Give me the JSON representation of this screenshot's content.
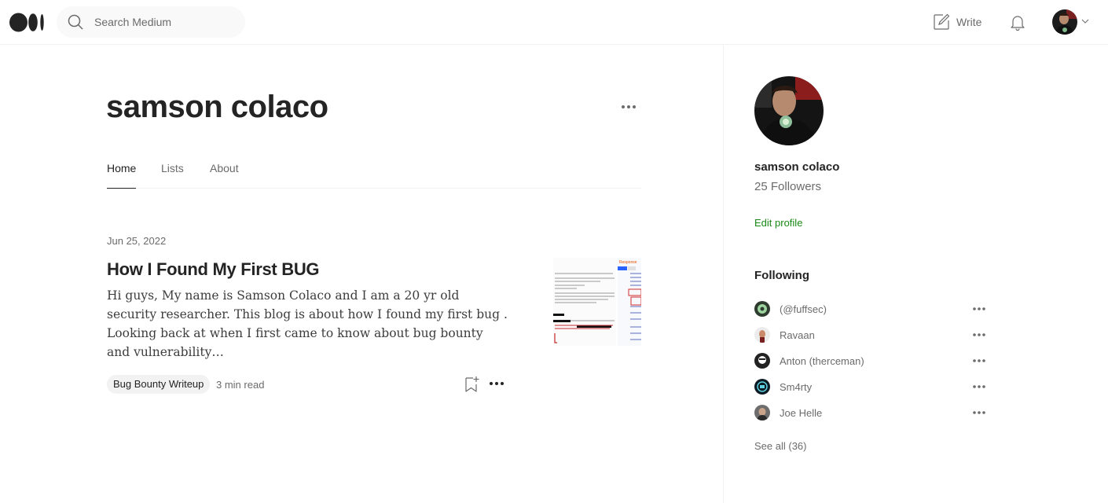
{
  "header": {
    "search_placeholder": "Search Medium",
    "write_label": "Write"
  },
  "profile": {
    "name": "samson colaco",
    "followers": "25 Followers",
    "edit_label": "Edit profile"
  },
  "tabs": [
    {
      "label": "Home",
      "active": true
    },
    {
      "label": "Lists",
      "active": false
    },
    {
      "label": "About",
      "active": false
    }
  ],
  "post": {
    "date": "Jun 25, 2022",
    "title": "How I Found My First BUG",
    "excerpt": "Hi guys, My name is Samson Colaco and I am a 20 yr old security researcher. This blog is about how I found my first bug . Looking back at when I first came to know about bug bounty and vulnerability…",
    "tag": "Bug Bounty Writeup",
    "read_time": "3 min read"
  },
  "following": {
    "title": "Following",
    "items": [
      {
        "name": "(@fuffsec)"
      },
      {
        "name": "Ravaan"
      },
      {
        "name": "Anton (therceman)"
      },
      {
        "name": "Sm4rty"
      },
      {
        "name": "Joe Helle"
      }
    ],
    "see_all": "See all (36)"
  },
  "colors": {
    "accent_green": "#1a8917",
    "text_primary": "#242424",
    "text_secondary": "#6b6b6b"
  }
}
